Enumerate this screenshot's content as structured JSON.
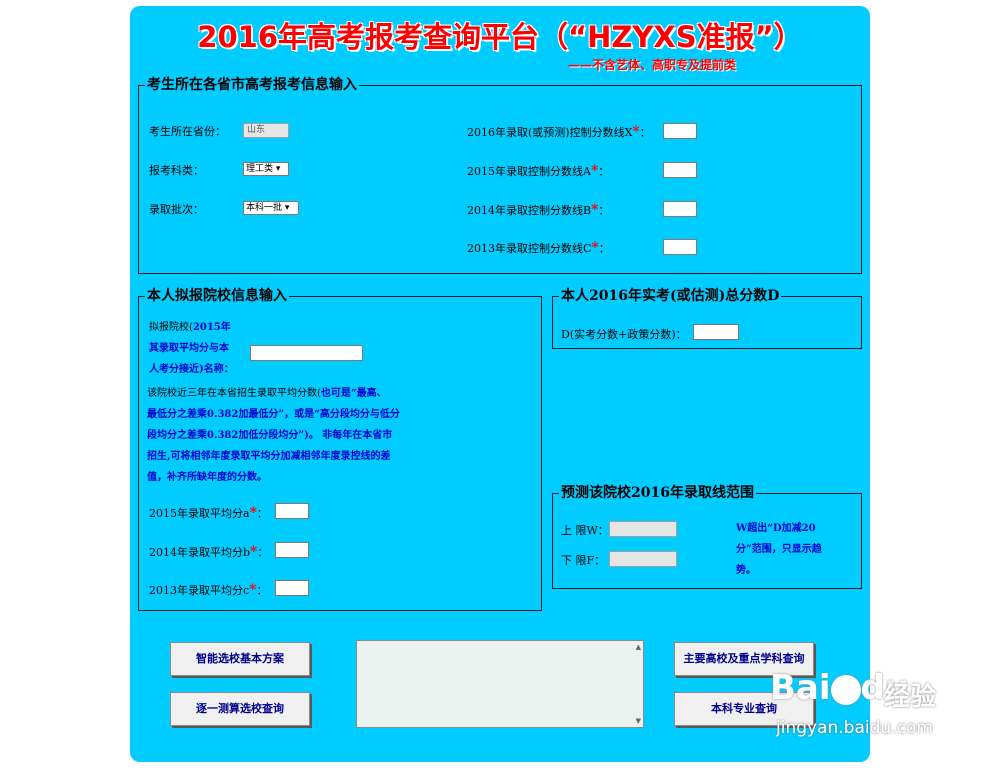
{
  "title": "2016年高考报考查询平台（“HZYXS准报”）",
  "subtitle": "——不含艺体、高职专及提前类",
  "section1": {
    "legend": "考生所在各省市高考报考信息输入",
    "province_label": "考生所在省份：",
    "province_value": "山东",
    "subject_label": "报考科类：",
    "subject_value": "理工类 ▾",
    "batch_label": "录取批次：",
    "batch_value": "本科一批 ▾",
    "x_label": "2016年录取(或预测)控制分数线X",
    "a_label": "2015年录取控制分数线A",
    "b_label": "2014年录取控制分数线B",
    "c_label": "2013年录取控制分数线C",
    "star": "*",
    "colon": "："
  },
  "section2": {
    "legend": "本人拟报院校信息输入",
    "school_line1_a": "拟报院校(",
    "school_line1_b": "2015年",
    "school_line2": "其录取平均分与本",
    "school_line3": "人考分接近)名称：",
    "note_line1_a": "该院校近三年在本省招生录取平均分数(",
    "note_line1_b": "也可是“最高、",
    "note_line2": "最低分之差乘0.382加最低分”，或是“高分段均分与低分",
    "note_line3": "段均分之差乘0.382加低分段均分”)。 非每年在本省市",
    "note_line4": "招生,可将相邻年度录取平均分加减相邻年度录控线的差",
    "note_line5": "值，补齐所缺年度的分数。",
    "a_label": "2015年录取平均分a",
    "b_label": "2014年录取平均分b",
    "c_label": "2013年录取平均分c"
  },
  "section3": {
    "legend": "本人2016年实考(或估测)总分数D",
    "d_label": "D(实考分数+政策分数)："
  },
  "section4": {
    "legend": "预测该院校2016年录取线范围",
    "upper_label": "上 限W：",
    "lower_label": "下 限F：",
    "note": "W超出“D加减20分”范围，只显示趋势。"
  },
  "buttons": {
    "basic_plan": "智能选校基本方案",
    "calc_query": "逐一测算选校查询",
    "key_schools": "主要高校及重点学科查询",
    "major_query": "本科专业查询"
  },
  "watermark": {
    "brand": "Bai",
    "brand2": "du",
    "brand_cn": "经验",
    "url": "jingyan.baidu.com"
  },
  "colors": {
    "panel": "#00ccff",
    "title": "#ff0000",
    "accent_text": "#0000cc"
  }
}
